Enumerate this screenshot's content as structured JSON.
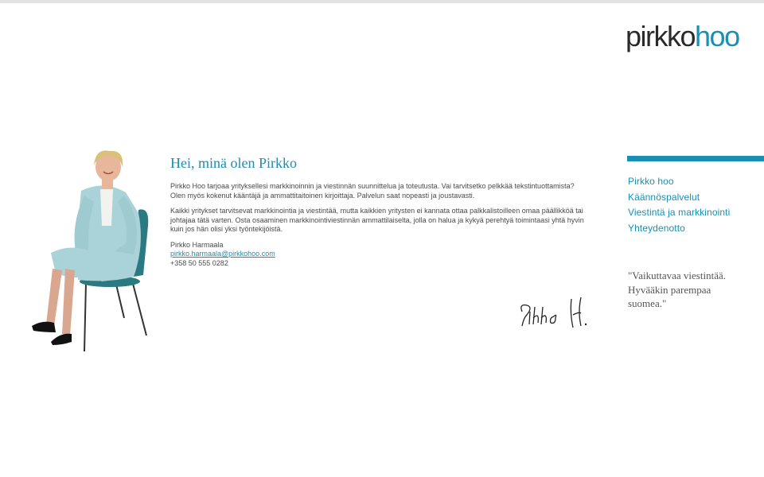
{
  "logo": {
    "first": "pirkko",
    "second": "hoo",
    "color_dark": "#2a2a2a",
    "color_accent": "#1a8fb3"
  },
  "main": {
    "heading": "Hei, minä olen Pirkko",
    "paragraph1": "Pirkko Hoo tarjoaa yrityksellesi markkinoinnin ja viestinnän suunnittelua ja toteutusta. Vai tarvitsetko pelkkää tekstintuottamista? Olen myös kokenut kääntäjä ja ammattitaitoinen kirjoittaja. Palvelun saat nopeasti ja joustavasti.",
    "paragraph2": "Kaikki yritykset tarvitsevat markkinointia ja viestintää, mutta kaikkien yritysten ei kannata ottaa palkkalistoilleen omaa päällikköä tai johtajaa tätä varten. Osta osaaminen markkinointiviestinnän ammattilaiselta, jolla on halua ja kykyä perehtyä toimintaasi yhtä hyvin kuin jos hän olisi yksi työntekijöistä.",
    "contact": {
      "name": "Pirkko Harmaala",
      "email": "pirkko.harmaala@pirkkohoo.com",
      "phone": "+358 50 555 0282"
    },
    "signature_alt": "Pirkko H."
  },
  "nav": {
    "items": [
      {
        "label": "Pirkko hoo"
      },
      {
        "label": "Käännöspalvelut"
      },
      {
        "label": "Viestintä ja markkinointi"
      },
      {
        "label": "Yhteydenotto"
      }
    ]
  },
  "quote": {
    "text": "\"Vaikuttavaa viestintää.\nHyvääkin parempaa\nsuomea.\""
  },
  "colors": {
    "accent": "#1a8fb3",
    "body_text": "#4a4a4a",
    "jacket": "#a9d3d8"
  },
  "icons": {
    "figure": "woman-seated-on-chair-photo",
    "signature": "handwritten-signature"
  }
}
